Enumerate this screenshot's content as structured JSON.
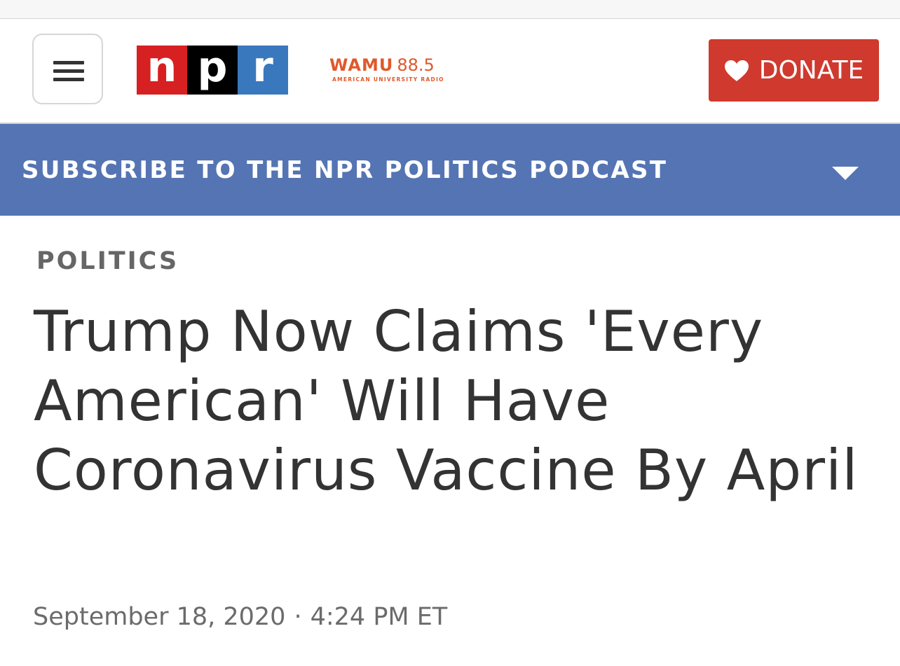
{
  "header": {
    "logo": {
      "letters": [
        "n",
        "p",
        "r"
      ],
      "colors": [
        "#d62021",
        "#000000",
        "#3a78be"
      ]
    },
    "station": {
      "name": "WAMU",
      "frequency": "88.5",
      "tagline": "AMERICAN UNIVERSITY RADIO",
      "color": "#e0592a"
    },
    "donate_label": "DONATE",
    "donate_color": "#d0392d",
    "menu_icon": "hamburger-menu-icon",
    "donate_icon": "heart-icon"
  },
  "banner": {
    "text": "SUBSCRIBE TO THE NPR POLITICS PODCAST",
    "color": "#5574b3",
    "icon": "chevron-down-icon"
  },
  "article": {
    "section": "POLITICS",
    "headline": "Trump Now Claims 'Every American' Will Have Coronavirus Vaccine By April",
    "date": "September 18, 2020",
    "separator": "·",
    "time": "4:24 PM ET"
  }
}
